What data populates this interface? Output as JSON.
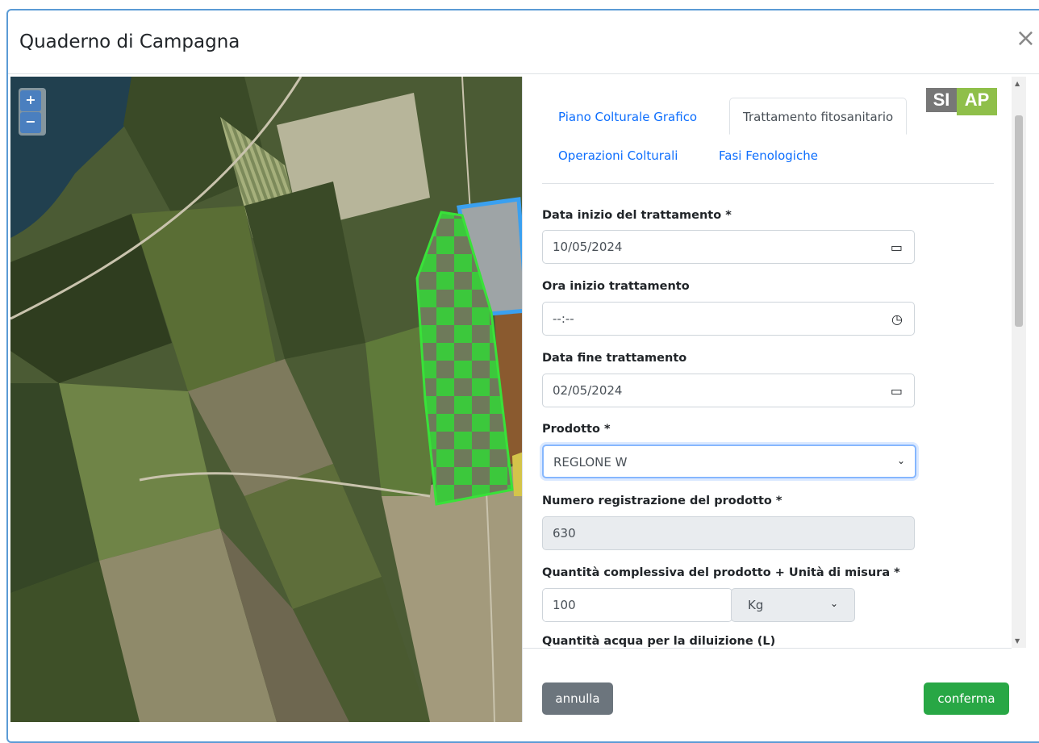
{
  "modal": {
    "title": "Quaderno di Campagna",
    "close_symbol": "×"
  },
  "map": {
    "zoom_in": "+",
    "zoom_out": "−"
  },
  "logo": {
    "text_1": "SI",
    "text_2": "AP"
  },
  "tabs": [
    {
      "label": "Piano Colturale Grafico",
      "active": false
    },
    {
      "label": "Trattamento fitosanitario",
      "active": true
    },
    {
      "label": "Operazioni Colturali",
      "active": false
    },
    {
      "label": "Fasi Fenologiche",
      "active": false
    }
  ],
  "form": {
    "data_inizio": {
      "label": "Data inizio del trattamento *",
      "value": "10/05/2024",
      "icon": "calendar-icon"
    },
    "ora_inizio": {
      "label": "Ora inizio trattamento",
      "value": "--:--",
      "icon": "clock-icon"
    },
    "data_fine": {
      "label": "Data fine trattamento",
      "value": "02/05/2024",
      "icon": "calendar-icon"
    },
    "prodotto": {
      "label": "Prodotto *",
      "value": "REGLONE W"
    },
    "numero_registrazione": {
      "label": "Numero registrazione del prodotto *",
      "value": "630"
    },
    "quantita": {
      "label": "Quantità complessiva del prodotto + Unità di misura *",
      "value": "100",
      "unit": "Kg"
    },
    "acqua": {
      "label": "Quantità acqua per la diluizione (L)"
    }
  },
  "footer": {
    "cancel_label": "annulla",
    "confirm_label": "conferma"
  },
  "colors": {
    "primary_link": "#0d6efd",
    "cancel_button": "#6c757d",
    "confirm_button": "#28a745",
    "modal_border": "#5b9bd5"
  }
}
